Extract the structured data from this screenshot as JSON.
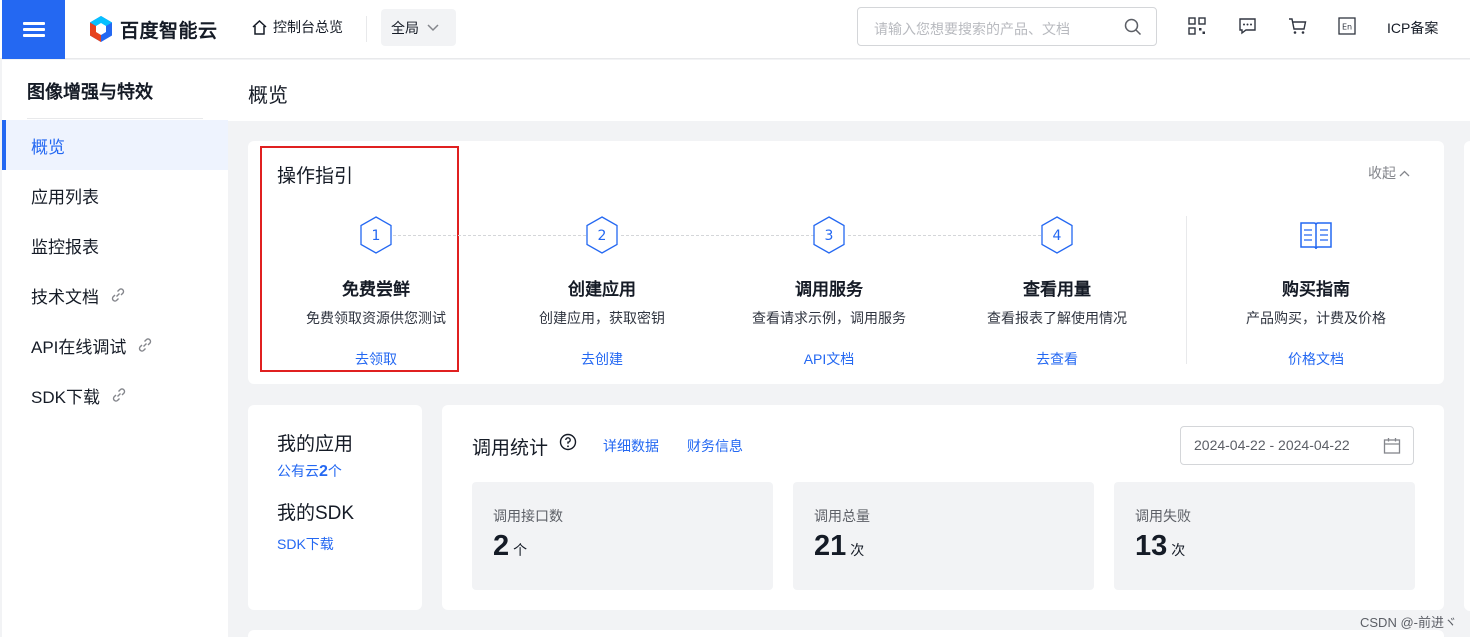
{
  "topbar": {
    "logo_text": "百度智能云",
    "console_label": "控制台总览",
    "region_label": "全局",
    "search_placeholder": "请输入您想要搜索的产品、文档",
    "icp_label": "ICP备案",
    "icons": [
      "qrcode-icon",
      "message-icon",
      "cart-icon",
      "language-icon"
    ]
  },
  "sidebar": {
    "title": "图像增强与特效",
    "items": [
      {
        "label": "概览",
        "active": true
      },
      {
        "label": "应用列表"
      },
      {
        "label": "监控报表"
      },
      {
        "label": "技术文档",
        "external": true
      },
      {
        "label": "API在线调试",
        "external": true
      },
      {
        "label": "SDK下载",
        "external": true
      }
    ]
  },
  "page": {
    "title": "概览"
  },
  "guide": {
    "title": "操作指引",
    "collapse_label": "收起",
    "steps": [
      {
        "number": "1",
        "name": "免费尝鲜",
        "desc": "免费领取资源供您测试",
        "link": "去领取"
      },
      {
        "number": "2",
        "name": "创建应用",
        "desc": "创建应用，获取密钥",
        "link": "去创建"
      },
      {
        "number": "3",
        "name": "调用服务",
        "desc": "查看请求示例，调用服务",
        "link": "API文档"
      },
      {
        "number": "4",
        "name": "查看用量",
        "desc": "查看报表了解使用情况",
        "link": "去查看"
      }
    ],
    "purchase": {
      "name": "购买指南",
      "desc": "产品购买，计费及价格",
      "link": "价格文档"
    }
  },
  "my_apps": {
    "title": "我的应用",
    "public_cloud_prefix": "公有云",
    "public_cloud_count": "2",
    "public_cloud_suffix": "个",
    "sdk_title": "我的SDK",
    "sdk_link": "SDK下载"
  },
  "stats": {
    "title": "调用统计",
    "detail_link": "详细数据",
    "finance_link": "财务信息",
    "date_range": "2024-04-22 - 2024-04-22",
    "metrics": [
      {
        "label": "调用接口数",
        "value": "2",
        "unit": "个"
      },
      {
        "label": "调用总量",
        "value": "21",
        "unit": "次"
      },
      {
        "label": "调用失败",
        "value": "13",
        "unit": "次"
      }
    ]
  },
  "watermark": "CSDN @-前进ヾ",
  "colors": {
    "primary": "#2468f2",
    "highlight": "#e02020",
    "background": "#f2f3f5"
  }
}
